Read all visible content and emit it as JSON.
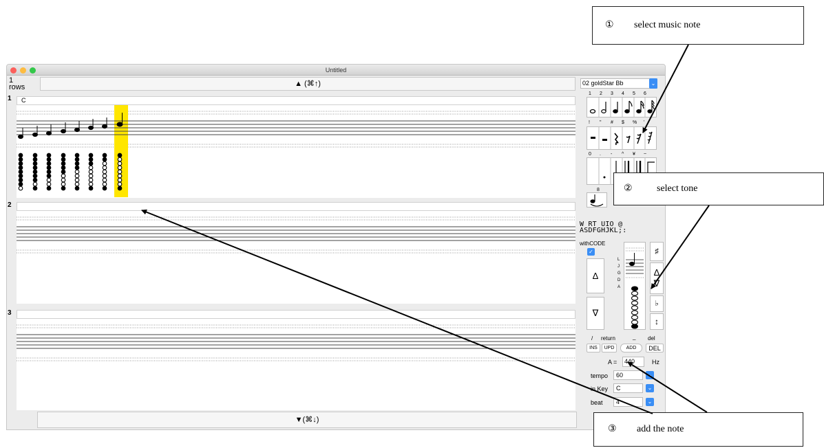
{
  "window": {
    "title": "Untitled"
  },
  "toolbar": {
    "rows_num": "1",
    "rows_label": "rows",
    "scroll_up": "▲ (⌘↑)",
    "scroll_down": "▼(⌘↓)"
  },
  "rows": [
    {
      "num": "1",
      "lyric": "C"
    },
    {
      "num": "2",
      "lyric": ""
    },
    {
      "num": "3",
      "lyric": ""
    }
  ],
  "sidebar": {
    "song_select": "02 goldStar Bb",
    "note_row1_keys": [
      "1",
      "2",
      "3",
      "4",
      "5",
      "6"
    ],
    "note_row2_keys": [
      "!",
      "\"",
      "#",
      "$",
      "%",
      "'"
    ],
    "note_row3_keys": [
      "0",
      ".",
      "-",
      "^",
      "¥",
      "~"
    ],
    "note_row4_keys": [
      "8"
    ],
    "keyboard_top": "W RT UIO @",
    "keyboard_bottom": "ASDFGHJKL;:",
    "with_code_label": "withCODE",
    "staff_letters": [
      "L",
      "J",
      "G",
      "D",
      "A"
    ],
    "up_label": "Δ",
    "down_label": "∇",
    "sharp_label": "♯",
    "flat_label": "♭",
    "updown_label": "↕",
    "ins_hint": "/",
    "return_hint": "return",
    "under_hint": "_",
    "del_hint": "del",
    "ins_btn": "INS",
    "upd_btn": "UPD",
    "add_btn": "ADD",
    "del_btn": "DEL",
    "a_label": "A =",
    "a_value": "440",
    "hz_label": "Hz",
    "tempo_label": "tempo",
    "tempo_value": "60",
    "key_label": "in Key",
    "key_value": "C",
    "beat_label": "beat",
    "beat_value": "4"
  },
  "annotations": [
    {
      "num": "①",
      "text": "select music note"
    },
    {
      "num": "②",
      "text": "select tone"
    },
    {
      "num": "③",
      "text": "add the note"
    }
  ],
  "colors": {
    "accent": "#3a8ef5",
    "highlight": "#ffe600",
    "close": "#fc605c",
    "min": "#fdbc40",
    "max": "#34c84a"
  }
}
